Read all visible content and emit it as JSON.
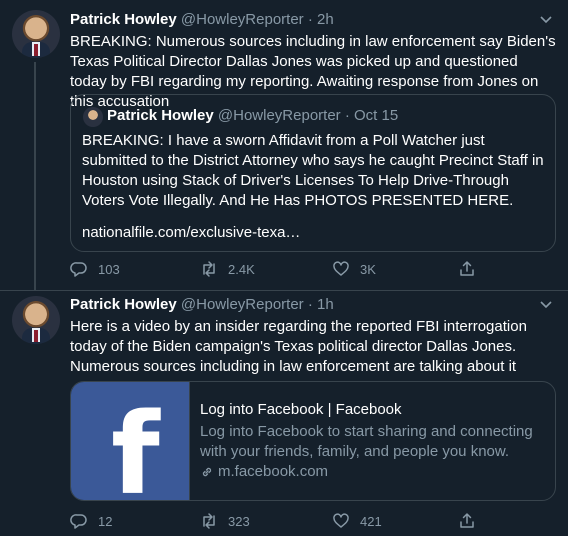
{
  "tweets": [
    {
      "name": "Patrick Howley",
      "handle": "@HowleyReporter",
      "sep": "·",
      "time": "2h",
      "text": "BREAKING: Numerous sources including in law enforcement say Biden's Texas Political Director Dallas Jones was picked up and questioned today by FBI regarding my reporting. Awaiting response from Jones on this accusation",
      "quote": {
        "name": "Patrick Howley",
        "handle": "@HowleyReporter",
        "sep": "·",
        "date": "Oct 15",
        "text": "BREAKING: I have a sworn Affidavit from a Poll Watcher just submitted to the District Attorney who says he caught Precinct Staff in Houston using Stack of Driver's Licenses To Help Drive-Through Voters Vote Illegally. And He Has PHOTOS PRESENTED HERE.",
        "link": "nationalfile.com/exclusive-texa…"
      },
      "stats": {
        "replies": "103",
        "retweets": "2.4K",
        "likes": "3K"
      }
    },
    {
      "name": "Patrick Howley",
      "handle": "@HowleyReporter",
      "sep": "·",
      "time": "1h",
      "text": "Here is a video by an insider regarding the reported FBI interrogation today of the Biden campaign's Texas political director Dallas Jones. Numerous sources including in law enforcement are talking about it",
      "card": {
        "title": "Log into Facebook | Facebook",
        "description": "Log into Facebook to start sharing and connecting with your friends, family, and people you know.",
        "domain": "m.facebook.com",
        "image_icon": "facebook-f-logo"
      },
      "stats": {
        "replies": "12",
        "retweets": "323",
        "likes": "421"
      }
    }
  ],
  "colors": {
    "background": "#15202b",
    "border": "#38444d",
    "muted": "#8899a6",
    "facebook_blue": "#3b5998"
  }
}
